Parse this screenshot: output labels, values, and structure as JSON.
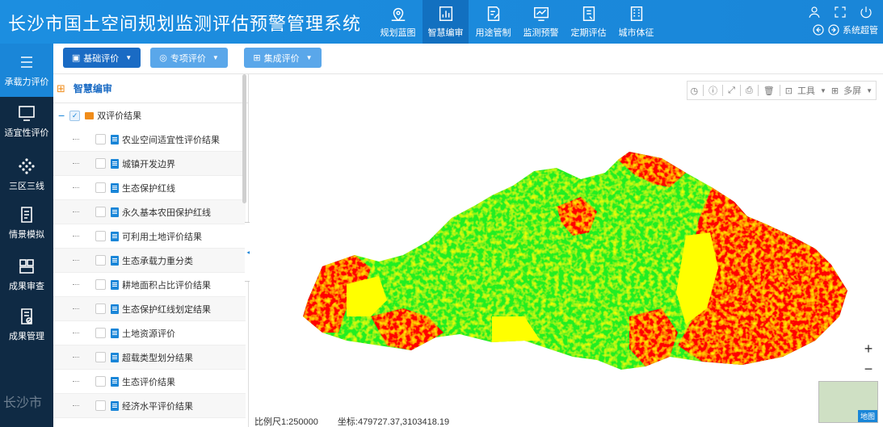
{
  "header": {
    "title": "长沙市国土空间规划监测评估预警管理系统",
    "nav": [
      {
        "label": "规划蓝图",
        "icon": "map-pin-icon",
        "active": false
      },
      {
        "label": "智慧编审",
        "icon": "building-chart-icon",
        "active": true
      },
      {
        "label": "用途管制",
        "icon": "edit-doc-icon",
        "active": false
      },
      {
        "label": "监测预警",
        "icon": "monitor-icon",
        "active": false
      },
      {
        "label": "定期评估",
        "icon": "report-icon",
        "active": false
      },
      {
        "label": "城市体征",
        "icon": "city-building-icon",
        "active": false
      }
    ],
    "user_label": "系统超管"
  },
  "leftnav": [
    {
      "label": "承载力评价",
      "icon": "list-icon",
      "active": true
    },
    {
      "label": "适宜性评价",
      "icon": "screen-icon",
      "active": false
    },
    {
      "label": "三区三线",
      "icon": "network-icon",
      "active": false
    },
    {
      "label": "情景模拟",
      "icon": "document-icon",
      "active": false
    },
    {
      "label": "成果审查",
      "icon": "grid-icon",
      "active": false
    },
    {
      "label": "成果管理",
      "icon": "doc-check-icon",
      "active": false
    }
  ],
  "leftnav_watermark": "长沙市",
  "toolbar": {
    "basic_eval": "基础评价",
    "special_eval": "专项评价",
    "integrated_eval": "集成评价"
  },
  "panel": {
    "title": "智慧编审",
    "root_label": "双评价结果",
    "items": [
      "农业空间适宜性评价结果",
      "城镇开发边界",
      "生态保护红线",
      "永久基本农田保护红线",
      "可利用土地评价结果",
      "生态承载力重分类",
      "耕地面积占比评价结果",
      "生态保护红线划定结果",
      "土地资源评价",
      "超载类型划分结果",
      "生态评价结果",
      "经济水平评价结果"
    ]
  },
  "map": {
    "tools_label": "工具",
    "multiscreen_label": "多屏",
    "zoom_in": "+",
    "zoom_out": "−",
    "minimap_label": "地图",
    "scale_text": "比例尺1:250000",
    "coord_text": "坐标:479727.37,3103418.19",
    "colors": {
      "red": "#ff0000",
      "green": "#22ee22",
      "yellow": "#ffff00"
    }
  }
}
